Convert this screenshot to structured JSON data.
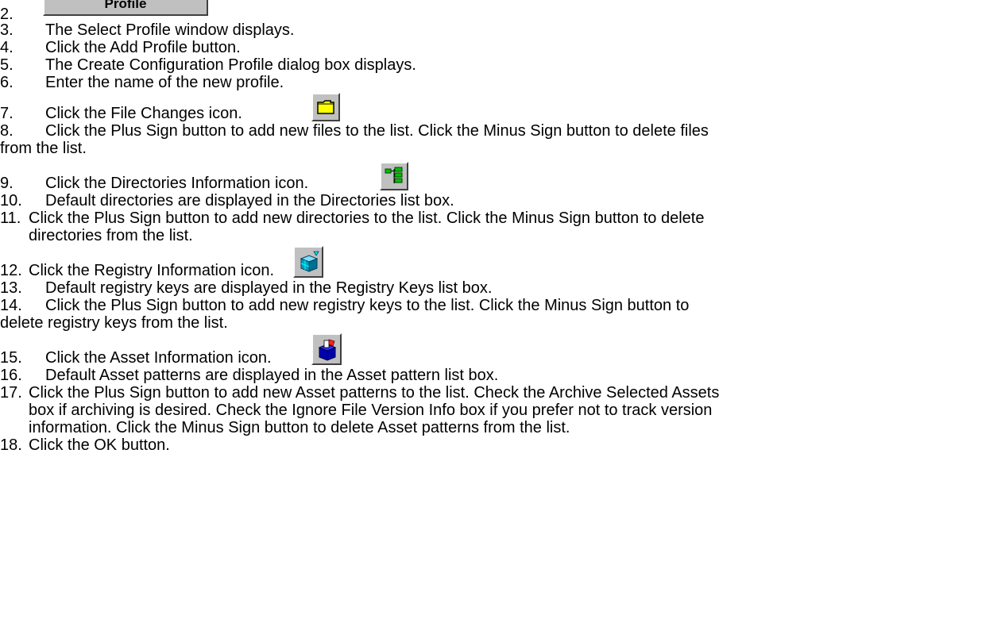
{
  "profile_button": {
    "label": "Profile"
  },
  "steps": [
    {
      "num": "2.",
      "text": ""
    },
    {
      "num": "3.",
      "text": "The Select Profile window displays."
    },
    {
      "num": "4.",
      "text": "Click the Add Profile button."
    },
    {
      "num": "5.",
      "text": "The Create Configuration Profile dialog box displays."
    },
    {
      "num": "6.",
      "text": "Enter the name of the new profile."
    },
    {
      "num": "7.",
      "text": "Click the File Changes icon."
    },
    {
      "num": "8.",
      "text": "Click   the Plus Sign button to add new files to the list.   Click the Minus Sign button to delete files",
      "cont": "from the list."
    },
    {
      "num": "9.",
      "text": "Click the Directories Information icon."
    },
    {
      "num": "10.",
      "text": "Default directories are displayed in the Directories list box."
    },
    {
      "num": "11.",
      "text": "Click   the Plus Sign button to add new directories to the list.   Click the Minus Sign button to delete",
      "cont": "directories from the list."
    },
    {
      "num": "12.",
      "text": "Click the Registry Information icon."
    },
    {
      "num": "13.",
      "text": "Default registry keys are displayed in the Registry Keys list box."
    },
    {
      "num": "14.",
      "text": "Click   the Plus Sign button to add new registry keys to the list.   Click the Minus Sign button to",
      "cont": "delete registry keys from the list."
    },
    {
      "num": "15.",
      "text": "Click the Asset Information icon."
    },
    {
      "num": "16.",
      "text": "Default Asset patterns are displayed in the Asset pattern list box."
    },
    {
      "num": "17.",
      "text": "Click   the Plus Sign button to add new Asset patterns to the list.   Check the Archive Selected Assets",
      "cont1": "box if archiving is desired.   Check the Ignore File Version Info box if you prefer not to track version",
      "cont2": "information.   Click the Minus Sign button to delete Asset patterns from the list."
    },
    {
      "num": "18.",
      "text": "Click the OK button."
    }
  ],
  "icons": {
    "file_changes": "folder-icon",
    "directories": "directory-tree-icon",
    "registry": "registry-cube-icon",
    "asset": "asset-box-icon"
  }
}
